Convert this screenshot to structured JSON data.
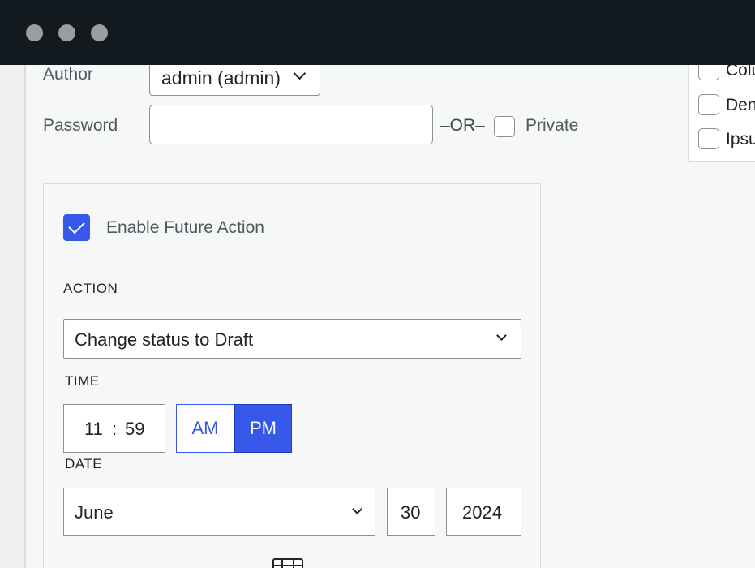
{
  "window": {
    "controls": [
      "close-dot",
      "minimize-dot",
      "zoom-dot"
    ]
  },
  "form": {
    "author_label": "Author",
    "author_value": "admin (admin)",
    "password_label": "Password",
    "password_value": "",
    "or_text": "–OR–",
    "private_label": "Private",
    "private_checked": false
  },
  "categories": [
    {
      "label": "Colu",
      "checked": false
    },
    {
      "label": "Den",
      "checked": false
    },
    {
      "label": "Ipsu",
      "checked": false
    }
  ],
  "future_action": {
    "enable_label": "Enable Future Action",
    "enabled": true,
    "action_heading": "ACTION",
    "action_value": "Change status to Draft",
    "time_heading": "TIME",
    "hour": "11",
    "separator": ":",
    "minute": "59",
    "am_label": "AM",
    "pm_label": "PM",
    "selected_period": "PM",
    "date_heading": "DATE",
    "month": "June",
    "day": "30",
    "year": "2024"
  },
  "colors": {
    "accent": "#3858e9",
    "titlebar": "#121a20"
  },
  "icons": {
    "select_arrow": "chevron-down-icon",
    "calendar": "calendar-icon"
  }
}
